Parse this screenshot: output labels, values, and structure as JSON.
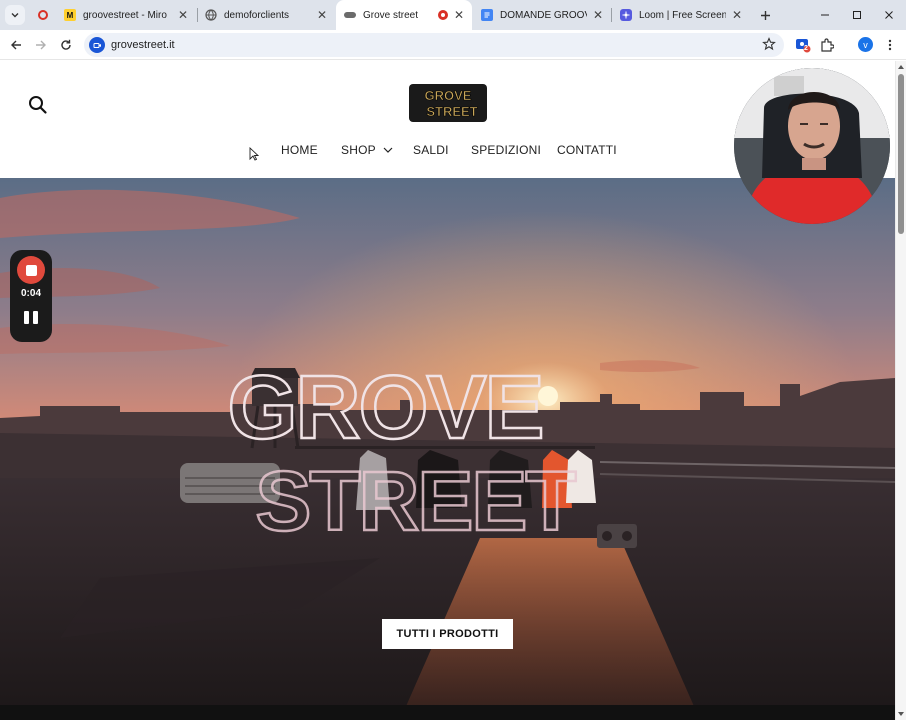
{
  "browser": {
    "tabs": [
      {
        "label": "groovestreet - Miro",
        "favicon": "miro-icon",
        "recording": true
      },
      {
        "label": "demoforclients",
        "favicon": "globe-icon",
        "recording": false
      },
      {
        "label": "Grove street",
        "favicon": "site-icon",
        "recording": true,
        "active": true
      },
      {
        "label": "DOMANDE GROOVE - ",
        "favicon": "docs-icon",
        "recording": false
      },
      {
        "label": "Loom | Free Screen & V",
        "favicon": "loom-icon",
        "recording": false
      }
    ],
    "address": "grovestreet.it",
    "profile_initial": "v",
    "extension_badge": "2"
  },
  "site": {
    "logo_text_top": "GROVE",
    "logo_text_bottom": "STREET",
    "nav": {
      "home": "HOME",
      "shop": "SHOP",
      "saldi": "SALDI",
      "spedizioni": "SPEDIZIONI",
      "contatti": "CONTATTI"
    },
    "hero": {
      "title_top": "GROVE",
      "title_bottom": "STREET",
      "cta": "TUTTI I PRODOTTI"
    }
  },
  "recorder": {
    "elapsed": "0:04"
  },
  "colors": {
    "accent_record": "#e0493c",
    "chrome_bg": "#dee3eb",
    "omnibox_bg": "#edf1f8",
    "profile": "#1a73e8"
  }
}
